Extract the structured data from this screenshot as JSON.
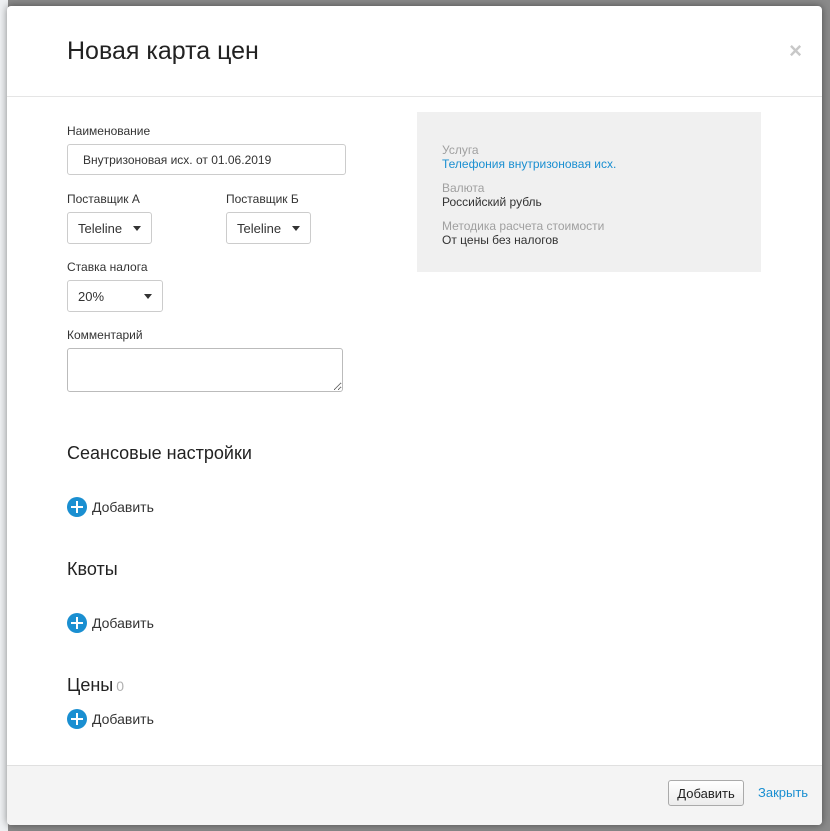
{
  "modal": {
    "title": "Новая карта цен",
    "close_symbol": "×"
  },
  "form": {
    "name_label": "Наименование",
    "name_value": "Внутризоновая исх. от 01.06.2019",
    "supplier_a_label": "Поставщик А",
    "supplier_a_value": "Teleline",
    "supplier_b_label": "Поставщик Б",
    "supplier_b_value": "Teleline",
    "tax_label": "Ставка налога",
    "tax_value": "20%",
    "comment_label": "Комментарий",
    "comment_value": ""
  },
  "info": {
    "service_label": "Услуга",
    "service_value": "Телефония внутризоновая исх.",
    "currency_label": "Валюта",
    "currency_value": "Российский рубль",
    "method_label": "Методика расчета стоимости",
    "method_value": "От цены без налогов"
  },
  "sections": {
    "session": {
      "title": "Сеансовые настройки",
      "add_label": "Добавить"
    },
    "quotas": {
      "title": "Квоты",
      "add_label": "Добавить"
    },
    "prices": {
      "title": "Цены",
      "count": "0",
      "add_label": "Добавить"
    }
  },
  "footer": {
    "add_button": "Добавить",
    "close_link": "Закрыть"
  },
  "colors": {
    "accent": "#1a8fd1",
    "panel_bg": "#f0f0f0"
  },
  "icons": [
    "close-icon",
    "caret-down-icon",
    "plus-circle-icon"
  ]
}
